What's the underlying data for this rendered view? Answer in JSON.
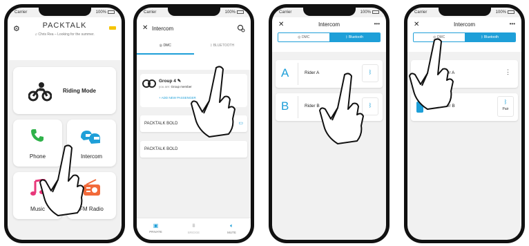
{
  "status": {
    "carrier": "Carrier",
    "battery": "100%"
  },
  "phone1": {
    "title": "PACKTALK",
    "subtitle": "Chris Rea – Looking for the summer.",
    "riding_mode": "Riding Mode",
    "phone": "Phone",
    "intercom": "Intercom",
    "music": "Music",
    "fm_radio": "FM Radio"
  },
  "phone2": {
    "title": "Intercom",
    "tab_dmc": "DMC",
    "tab_bluetooth": "BLUETOOTH",
    "group_name": "Group 4",
    "you_are_label": "you are:",
    "you_are_value": "Group member",
    "add_passenger": "+ ADD NEW PASSENGER",
    "device_1": "PACKTALK BOLD",
    "device_2": "PACKTALK BOLD",
    "bottom": {
      "private": "PRIVATE",
      "bridge": "BRIDGE",
      "mute": "MUTE"
    }
  },
  "phone3": {
    "title": "Intercom",
    "seg_dmc": "DMC",
    "seg_bluetooth": "Bluetooth",
    "rider_a_letter": "A",
    "rider_a": "Rider A",
    "rider_b_letter": "B",
    "rider_b": "Rider B"
  },
  "phone4": {
    "title": "Intercom",
    "seg_dmc": "DMC",
    "seg_bluetooth": "Bluetooth",
    "rider_a": "Rider A",
    "rider_b": "Rider B",
    "pair": "Pair"
  },
  "colors": {
    "accent": "#1e9fd8",
    "phone_green": "#2fb24a",
    "music_pink": "#e8387a",
    "radio_orange": "#f26a3a",
    "battery_yellow": "#f5c400"
  }
}
